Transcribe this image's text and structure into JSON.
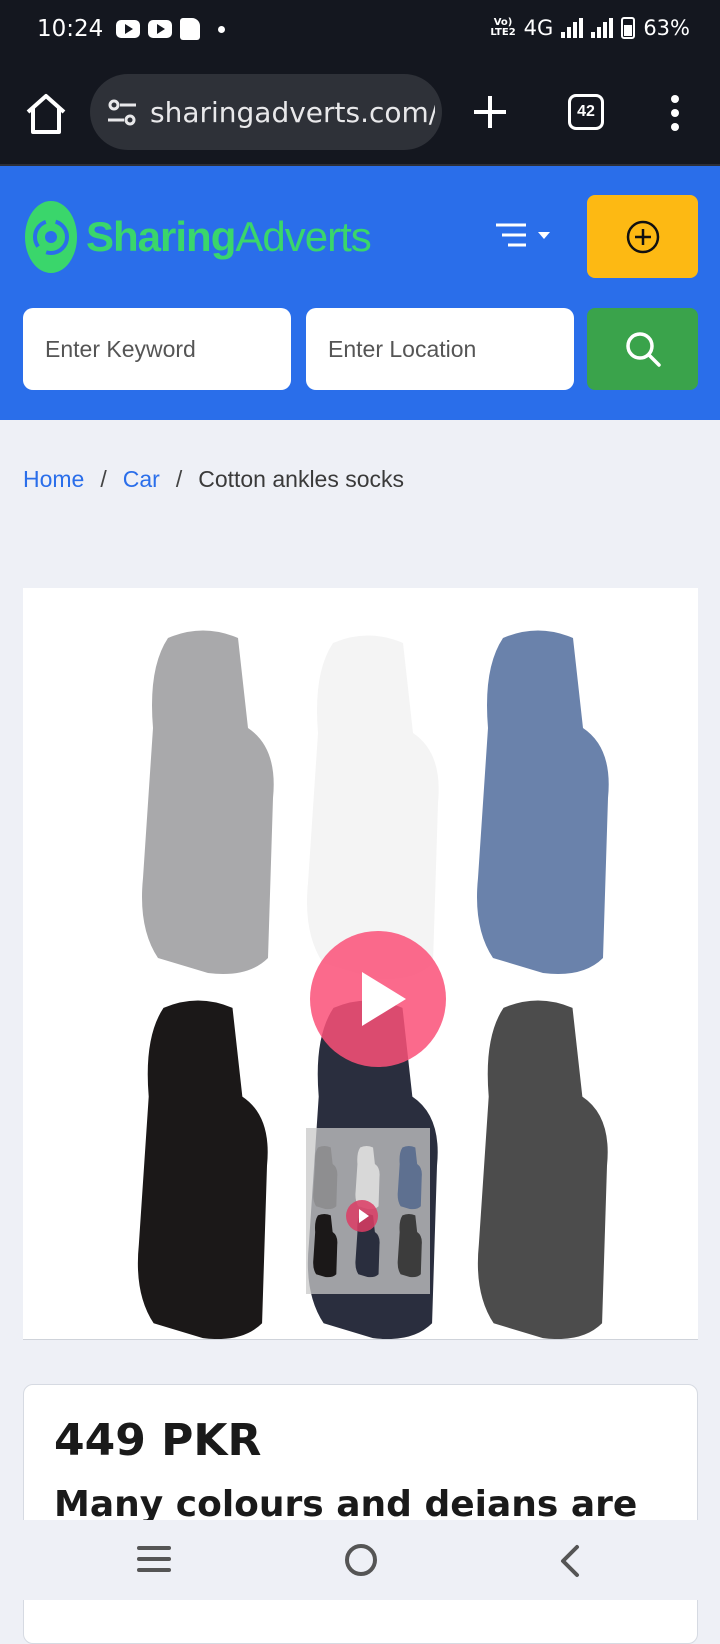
{
  "status_bar": {
    "time": "10:24",
    "network": "4G",
    "volte": "Vo) LTE2",
    "battery": "63%"
  },
  "browser": {
    "url": "sharingadverts.com/",
    "tab_count": "42"
  },
  "header": {
    "logo_bold": "Sharing",
    "logo_light": "Adverts",
    "keyword_placeholder": "Enter Keyword",
    "location_placeholder": "Enter Location"
  },
  "breadcrumb": {
    "home": "Home",
    "category": "Car",
    "current": "Cotton ankles socks",
    "separator": "/"
  },
  "listing": {
    "price": "449 PKR",
    "title": "Many colours and deians are"
  },
  "colors": {
    "header_blue": "#2a6eea",
    "post_yellow": "#fdb913",
    "search_green": "#3aa34b",
    "logo_green": "#3ad66b",
    "play_pink": "#fa5078"
  },
  "icons": {
    "home": "home-icon",
    "tune": "site-settings-icon",
    "new_tab": "plus-icon",
    "menu": "more-vert-icon",
    "post_ad": "plus-circle-icon",
    "search": "search-icon",
    "play": "play-icon"
  }
}
